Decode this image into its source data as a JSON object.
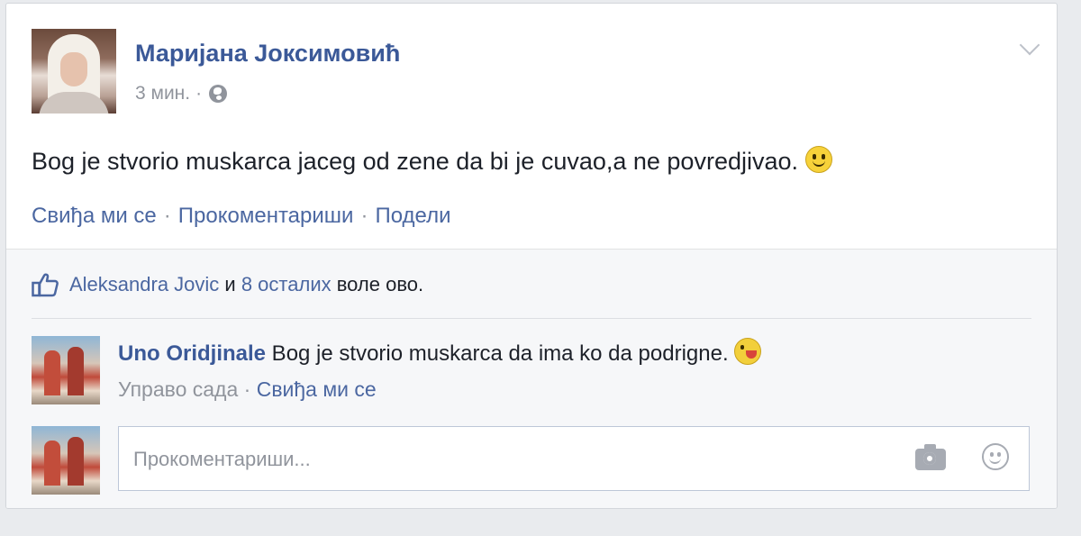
{
  "post": {
    "author": "Маријана Јоксимовић",
    "time": "3 мин.",
    "meta_separator": "·",
    "privacy_icon": "globe-icon",
    "menu_icon": "chevron-down-icon",
    "text": "Bog je stvorio muskarca jaceg od zene da bi je cuvao,a ne povredjivao.",
    "emoji": "smiley-icon",
    "actions": {
      "like": "Свиђа ми се",
      "comment": "Прокоментариши",
      "share": "Подели",
      "separator": "·"
    }
  },
  "feedback": {
    "like_icon": "thumbs-up-icon",
    "likers_name": "Aleksandra Jovic",
    "likers_conj": " и ",
    "likers_others": "8 осталих",
    "likers_suffix": " воле ово."
  },
  "comments": [
    {
      "author": "Uno Oridjinale",
      "text": " Bog je stvorio muskarca da ima ko da podrigne.",
      "emoji": "tongue-emoji-icon",
      "time": "Управо сада",
      "separator": " · ",
      "like_label": "Свиђа ми се"
    }
  ],
  "composer": {
    "placeholder": "Прокоментариши...",
    "camera_icon": "camera-icon",
    "emoji_icon": "emoji-picker-icon"
  },
  "colors": {
    "link_blue": "#4b67a1",
    "name_blue": "#3b5998",
    "muted_gray": "#90949c",
    "feedback_bg": "#f6f7f9"
  }
}
